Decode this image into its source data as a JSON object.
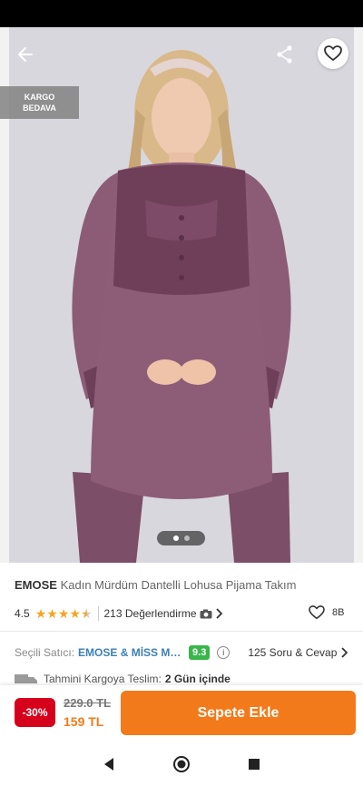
{
  "hero": {
    "badge_line1": "KARGO",
    "badge_line2": "BEDAVA",
    "back_icon": "arrow-left-icon",
    "share_icon": "share-icon",
    "favorite_icon": "heart-outline-icon",
    "image_count": 2,
    "active_image": 1
  },
  "product": {
    "brand": "EMOSE",
    "name": "Kadın Mürdüm Dantelli Lohusa Pijama Takım"
  },
  "rating": {
    "score": "4.5",
    "stars_value": 4.5,
    "reviews_label": "213 Değerlendirme",
    "likes": "8B"
  },
  "seller": {
    "label": "Seçili Satıcı:",
    "name": "EMOSE & MİSS ME...",
    "score": "9.3",
    "qa_label": "125 Soru & Cevap"
  },
  "cargo": {
    "label": "Tahmini Kargoya Teslim:",
    "value": "2 Gün içinde"
  },
  "purchase": {
    "discount": "-30%",
    "old_price": "229.0 TL",
    "new_price": "159 TL",
    "cart_label": "Sepete Ekle"
  },
  "colors": {
    "accent": "#f27a1a",
    "discount": "#d6001c",
    "seller_link": "#3b7fb5",
    "score_badge": "#38b64a",
    "star": "#f5a623",
    "garment": "#8a5a74"
  }
}
